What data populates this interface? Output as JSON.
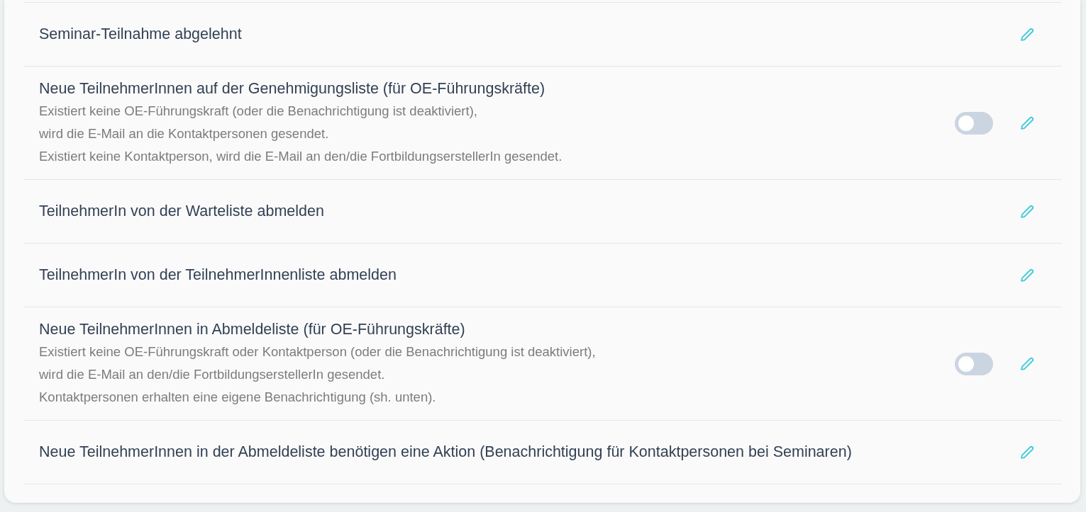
{
  "notifications": [
    {
      "kind": "plain",
      "title": "Seminar-Teilnahme abgelehnt"
    },
    {
      "kind": "toggle",
      "on": false,
      "title": "Neue TeilnehmerInnen auf der Genehmigungsliste (für OE-Führungskräfte)",
      "description": [
        "Existiert keine OE-Führungskraft (oder die Benachrichtigung ist deaktiviert),",
        "wird die E-Mail an die Kontaktpersonen gesendet.",
        "Existiert keine Kontaktperson, wird die E-Mail an den/die FortbildungserstellerIn gesendet."
      ]
    },
    {
      "kind": "plain",
      "title": "TeilnehmerIn von der Warteliste abmelden"
    },
    {
      "kind": "plain",
      "title": "TeilnehmerIn von der TeilnehmerInnenliste abmelden"
    },
    {
      "kind": "toggle",
      "on": false,
      "title": "Neue TeilnehmerInnen in Abmeldeliste (für OE-Führungskräfte)",
      "description": [
        "Existiert keine OE-Führungskraft oder Kontaktperson (oder die Benachrichtigung ist deaktiviert),",
        "wird die E-Mail an den/die FortbildungserstellerIn gesendet.",
        "Kontaktpersonen erhalten eine eigene Benachrichtigung (sh. unten)."
      ]
    },
    {
      "kind": "plain",
      "title": "Neue TeilnehmerInnen in der Abmeldeliste benötigen eine Aktion (Benachrichtigung für Kontaktpersonen bei Seminaren)"
    }
  ]
}
